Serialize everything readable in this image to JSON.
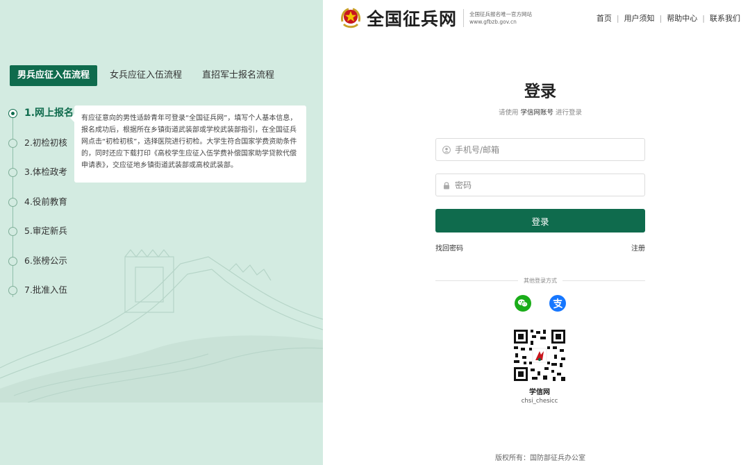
{
  "left_panel": {
    "tabs": [
      {
        "label": "男兵应征入伍流程",
        "active": true
      },
      {
        "label": "女兵应征入伍流程",
        "active": false
      },
      {
        "label": "直招军士报名流程",
        "active": false
      }
    ],
    "steps": [
      {
        "label": "1.网上报名",
        "active": true
      },
      {
        "label": "2.初检初核",
        "active": false
      },
      {
        "label": "3.体检政考",
        "active": false
      },
      {
        "label": "4.役前教育",
        "active": false
      },
      {
        "label": "5.审定新兵",
        "active": false
      },
      {
        "label": "6.张榜公示",
        "active": false
      },
      {
        "label": "7.批准入伍",
        "active": false
      }
    ],
    "info_text": "有应征意向的男性适龄青年可登录“全国征兵网”，填写个人基本信息，报名成功后，根据所在乡镇街道武装部或学校武装部指引，在全国征兵网点击“初检初核”，选择医院进行初检。大学生符合国家学费资助条件的，同时还应下载打印《高校学生应征入伍学费补偿国家助学贷款代偿申请表》，交应征地乡镇街道武装部或高校武装部。"
  },
  "header": {
    "site_title": "全国征兵网",
    "tagline": "全国征兵报名唯一官方网站",
    "domain": "www.gfbzb.gov.cn",
    "nav": [
      {
        "label": "首页"
      },
      {
        "label": "用户须知"
      },
      {
        "label": "帮助中心"
      },
      {
        "label": "联系我们"
      }
    ]
  },
  "login": {
    "title": "登录",
    "subtitle_prefix": "请使用",
    "subtitle_account": "学信网账号",
    "subtitle_suffix": "进行登录",
    "username_placeholder": "手机号/邮箱",
    "password_placeholder": "密码",
    "submit_label": "登录",
    "forgot_label": "找回密码",
    "register_label": "注册",
    "other_methods_label": "其他登录方式",
    "social_icons": [
      "wechat-icon",
      "alipay-icon"
    ],
    "qr_name": "学信网",
    "qr_id": "chsi_chesicc"
  },
  "footer": {
    "copyright": "版权所有：国防部征兵办公室"
  },
  "colors": {
    "primary": "#0f6b4d",
    "left_bg": "#d3ebe1",
    "wechat": "#1aad19",
    "alipay": "#1677ff"
  }
}
